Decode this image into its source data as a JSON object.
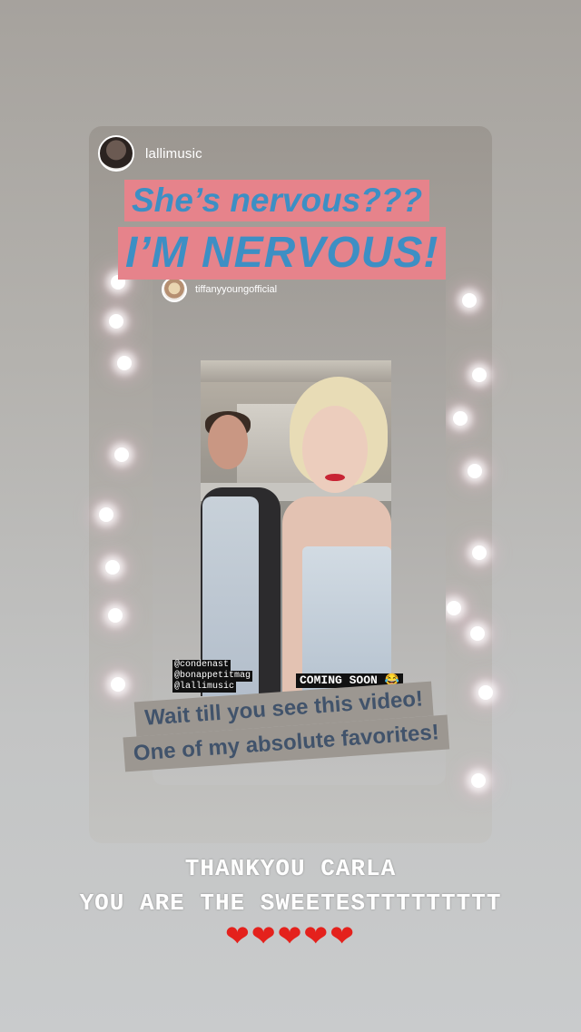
{
  "story": {
    "outer_username": "lallimusic",
    "headline_line1": "She’s nervous???",
    "headline_line2": "I’M NERVOUS!",
    "inner_username": "tiffanyyoungofficial",
    "tags": [
      "@condenast",
      "@bonappetitmag",
      "@lallimusic"
    ],
    "coming_soon": "COMING SOON 😂",
    "caption_line1": "Wait till you see this video!",
    "caption_line2": "One of my absolute favorites!",
    "bottom_line1": "THANKYOU CARLA",
    "bottom_line2": "YOU ARE THE SWEETESTTTTTTTTT",
    "hearts": "❤❤❤❤❤"
  },
  "colors": {
    "headline_text": "#3d8fc4",
    "headline_bg": "#e6838b",
    "caption_text": "#41536b",
    "hearts": "#e4211c"
  }
}
